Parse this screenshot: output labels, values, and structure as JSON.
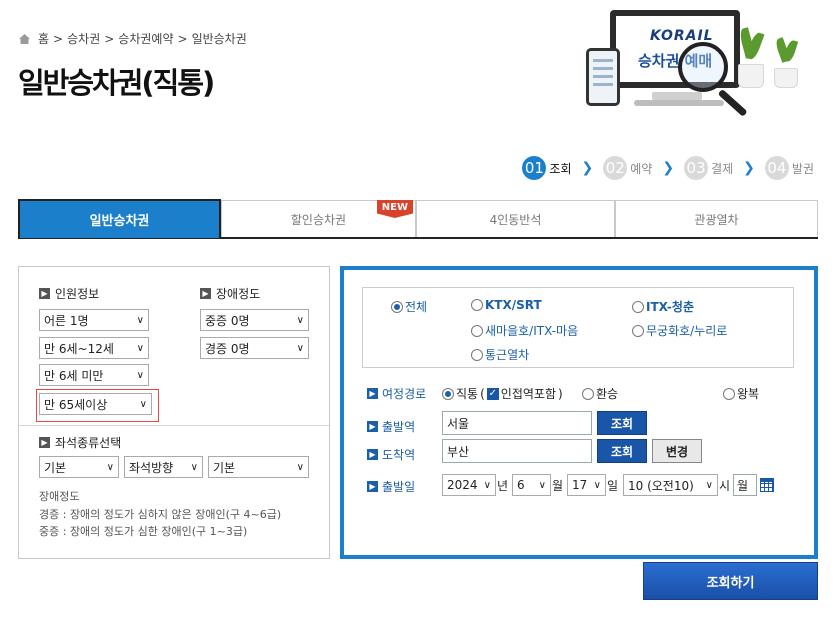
{
  "breadcrumb": [
    "홈",
    ">",
    "승차권",
    ">",
    "승차권예약",
    ">",
    "일반승차권"
  ],
  "page_title": "일반승차권(직통)",
  "hero": {
    "logo": "KORAIL",
    "caption": "승차권 예매"
  },
  "steps": [
    {
      "num": "01",
      "label": "조회"
    },
    {
      "num": "02",
      "label": "예약"
    },
    {
      "num": "03",
      "label": "결제"
    },
    {
      "num": "04",
      "label": "발권"
    }
  ],
  "tabs": [
    {
      "label": "일반승차권"
    },
    {
      "label": "할인승차권",
      "badge": "NEW"
    },
    {
      "label": "4인동반석"
    },
    {
      "label": "관광열차"
    }
  ],
  "passenger": {
    "title": "인원정보",
    "adult": "어른 1명",
    "child": "만 6세~12세",
    "infant": "만 6세 미만",
    "senior": "만 65세이상"
  },
  "disability": {
    "title": "장애정도",
    "severe": "중증 0명",
    "mild": "경증 0명"
  },
  "seat_type": {
    "title": "좌석종류선택",
    "option1": "기본",
    "option2": "좌석방향",
    "option3": "기본"
  },
  "notes": {
    "heading": "장애정도",
    "mild": "경증 : 장애의 정도가 심하지 않은 장애인(구 4~6급)",
    "severe": "중증 : 장애의 정도가 심한 장애인(구 1~3급)"
  },
  "train_types": {
    "all": "전체",
    "ktx": "KTX/SRT",
    "itx_cheongchun": "ITX-청춘",
    "saemaeul": "새마을호/ITX-마음",
    "mugunghwa": "무궁화호/누리로",
    "commuter": "통근열차"
  },
  "route": {
    "label": "여정경로",
    "direct": "직통",
    "nearby": "인접역포함",
    "transfer": "환승",
    "round_trip": "왕복"
  },
  "departure": {
    "label": "출발역",
    "value": "서울",
    "search": "조회"
  },
  "arrival": {
    "label": "도착역",
    "value": "부산",
    "search": "조회",
    "swap": "변경"
  },
  "date": {
    "label": "출발일",
    "year": "2024",
    "year_unit": "년",
    "month": "6",
    "month_unit": "월",
    "day": "17",
    "day_unit": "일",
    "hour": "10 (오전10)",
    "hour_unit": "시",
    "weekday": "월"
  },
  "submit": "조회하기",
  "colors": {
    "accent": "#1b7fcc",
    "button": "#1a56a8",
    "highlight": "#e24a4a"
  }
}
